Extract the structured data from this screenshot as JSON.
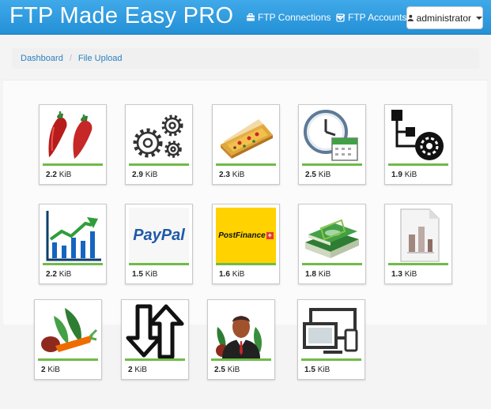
{
  "navbar": {
    "brand": "FTP Made Easy PRO",
    "connections_label": "FTP Connections",
    "accounts_label": "FTP Accounts",
    "user_label": "administrator"
  },
  "breadcrumb": {
    "home": "Dashboard",
    "current": "File Upload"
  },
  "colors": {
    "navbar": "#2e9be0",
    "size_bar": "#6fba48",
    "link": "#2a7fc0"
  },
  "files": [
    {
      "icon": "chili-peppers-icon",
      "size_value": "2.2",
      "size_unit": "KiB"
    },
    {
      "icon": "gears-icon",
      "size_value": "2.9",
      "size_unit": "KiB"
    },
    {
      "icon": "pizza-icon",
      "size_value": "2.3",
      "size_unit": "KiB"
    },
    {
      "icon": "clock-calendar-icon",
      "size_value": "2.5",
      "size_unit": "KiB"
    },
    {
      "icon": "network-gear-icon",
      "size_value": "1.9",
      "size_unit": "KiB"
    },
    {
      "icon": "growth-chart-icon",
      "size_value": "2.2",
      "size_unit": "KiB"
    },
    {
      "icon": "paypal-logo-icon",
      "size_value": "1.5",
      "size_unit": "KiB",
      "logo_text": "PayPal"
    },
    {
      "icon": "postfinance-logo-icon",
      "size_value": "1.6",
      "size_unit": "KiB",
      "logo_text": "PostFinance"
    },
    {
      "icon": "money-stack-icon",
      "size_value": "1.8",
      "size_unit": "KiB"
    },
    {
      "icon": "document-chart-icon",
      "size_value": "1.3",
      "size_unit": "KiB"
    },
    {
      "icon": "vegetables-icon",
      "size_value": "2",
      "size_unit": "KiB"
    },
    {
      "icon": "transfer-arrows-icon",
      "size_value": "2",
      "size_unit": "KiB"
    },
    {
      "icon": "businessman-icon",
      "size_value": "2.5",
      "size_unit": "KiB"
    },
    {
      "icon": "devices-icon",
      "size_value": "1.5",
      "size_unit": "KiB"
    }
  ]
}
